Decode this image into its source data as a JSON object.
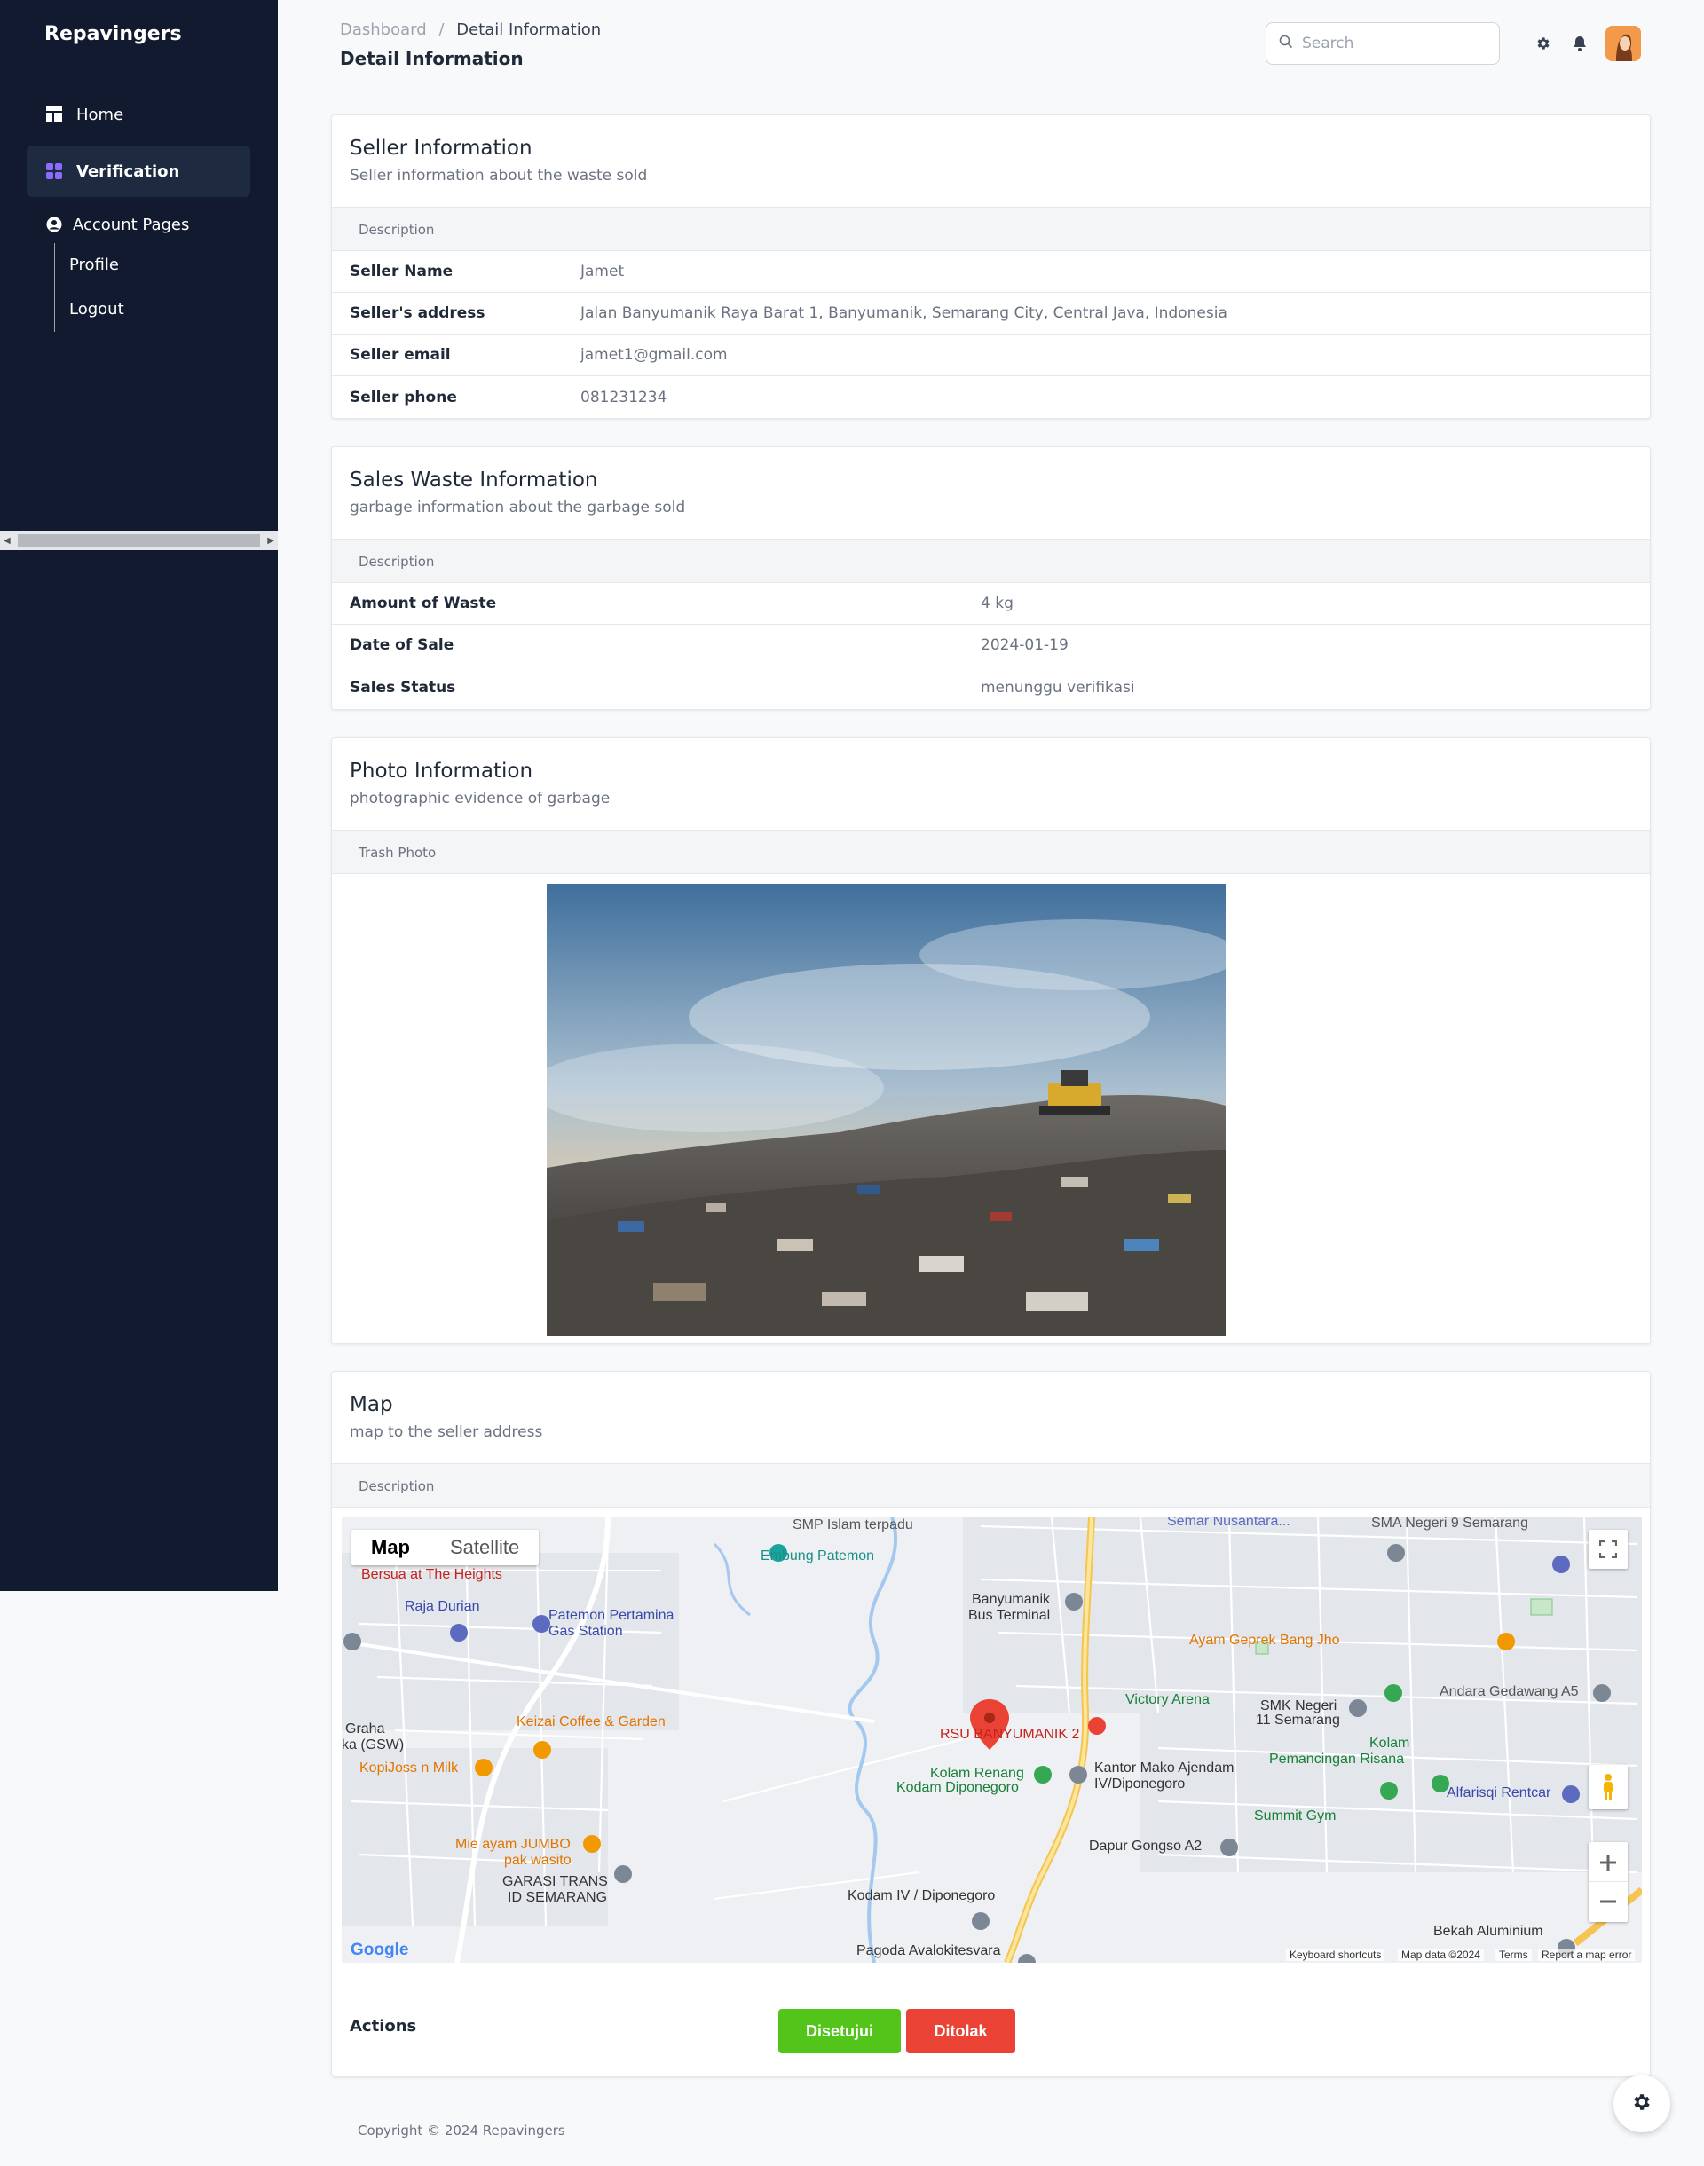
{
  "sidebar": {
    "brand": "Repavingers",
    "items": [
      {
        "label": "Home",
        "icon": "layout-icon"
      },
      {
        "label": "Verification",
        "icon": "grid-icon"
      },
      {
        "label": "Account Pages",
        "icon": "user-circle-icon"
      }
    ],
    "sub_items": [
      "Profile",
      "Logout"
    ]
  },
  "header": {
    "breadcrumb_root": "Dashboard",
    "breadcrumb_sep": "/",
    "breadcrumb_current": "Detail Information",
    "title": "Detail Information",
    "search_placeholder": "Search"
  },
  "seller": {
    "title": "Seller Information",
    "subtitle": "Seller information about the waste sold",
    "desc_label": "Description",
    "rows": [
      {
        "k": "Seller Name",
        "v": "Jamet"
      },
      {
        "k": "Seller's address",
        "v": "Jalan Banyumanik Raya Barat 1, Banyumanik, Semarang City, Central Java, Indonesia"
      },
      {
        "k": "Seller email",
        "v": "jamet1@gmail.com"
      },
      {
        "k": "Seller phone",
        "v": "081231234"
      }
    ]
  },
  "waste": {
    "title": "Sales Waste Information",
    "subtitle": "garbage information about the garbage sold",
    "desc_label": "Description",
    "rows": [
      {
        "k": "Amount of Waste",
        "v": "4 kg"
      },
      {
        "k": "Date of Sale",
        "v": "2024-01-19"
      },
      {
        "k": "Sales Status",
        "v": "menunggu verifikasi"
      }
    ]
  },
  "photo": {
    "title": "Photo Information",
    "subtitle": "photographic evidence of garbage",
    "desc_label": "Trash Photo"
  },
  "map": {
    "title": "Map",
    "subtitle": "map to the seller address",
    "desc_label": "Description",
    "type_map": "Map",
    "type_satellite": "Satellite",
    "labels": {
      "smp": "SMP Islam terpadu",
      "embung": "Embung Patemon",
      "semar": "Semar Nusantara...",
      "sma": "SMA Negeri 9 Semarang",
      "bersua": "Bersua at The Heights",
      "raja": "Raja Durian",
      "patemon1": "Patemon Pertamina",
      "patemon2": "Gas Station",
      "terminal1": "Banyumanik",
      "terminal2": "Bus Terminal",
      "ayam": "Ayam Geprek Bang Jho",
      "andara": "Andara Gedawang A5",
      "victory": "Victory Arena",
      "smk1": "SMK Negeri",
      "smk2": "11 Semarang",
      "graha1": "Graha",
      "graha2": "ka (GSW)",
      "keizai": "Keizai Coffee & Garden",
      "kopi": "KopiJoss n Milk",
      "rsu": "RSU BANYUMANIK 2",
      "kolam1": "Kolam Renang",
      "kolam2": "Kodam Diponegoro",
      "kantor1": "Kantor Mako Ajendam",
      "kantor2": "IV/Diponegoro",
      "pemancingan1": "Kolam",
      "pemancingan2": "Pemancingan Risana",
      "alfa": "Alfarisqi Rentcar",
      "summit": "Summit Gym",
      "dapur": "Dapur Gongso A2",
      "mie1": "Mie ayam JUMBO",
      "mie2": "pak wasito",
      "garasi1": "GARASI TRANS",
      "garasi2": "ID SEMARANG",
      "kodam": "Kodam IV / Diponegoro",
      "pagoda": "Pagoda Avalokitesvara",
      "bekah": "Bekah Aluminium",
      "google": "Google",
      "shortcuts": "Keyboard shortcuts",
      "mapdata": "Map data ©2024",
      "terms": "Terms",
      "report": "Report a map error"
    }
  },
  "actions": {
    "label": "Actions",
    "approve": "Disetujui",
    "reject": "Ditolak",
    "approve_color": "#52c41a",
    "reject_color": "#ea4335"
  },
  "footer": {
    "copyright": "Copyright © 2024 Repavingers"
  },
  "colors": {
    "sidebar_bg": "#111a2e",
    "accent": "#7c5cff"
  }
}
